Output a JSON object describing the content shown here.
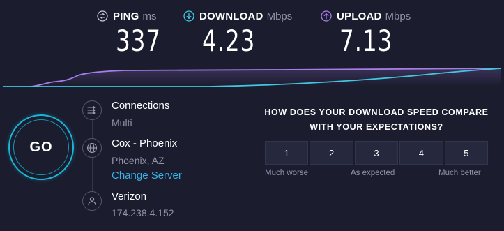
{
  "metrics": {
    "ping": {
      "label": "PING",
      "unit": "ms",
      "value": "337",
      "icon": "ping-icon",
      "color": "#ffffff"
    },
    "download": {
      "label": "DOWNLOAD",
      "unit": "Mbps",
      "value": "4.23",
      "icon": "download-arrow-icon",
      "color": "#41c8e0"
    },
    "upload": {
      "label": "UPLOAD",
      "unit": "Mbps",
      "value": "7.13",
      "icon": "upload-arrow-icon",
      "color": "#a77de8"
    }
  },
  "go_button": {
    "label": "GO"
  },
  "connections": {
    "title": "Connections",
    "mode": "Multi",
    "icon": "connections-icon"
  },
  "server": {
    "name": "Cox - Phoenix",
    "location": "Phoenix, AZ",
    "change_label": "Change Server",
    "icon": "globe-icon"
  },
  "provider": {
    "name": "Verizon",
    "ip": "174.238.4.152",
    "icon": "user-icon"
  },
  "survey": {
    "question_line1": "HOW DOES YOUR DOWNLOAD SPEED COMPARE",
    "question_line2": "WITH YOUR EXPECTATIONS?",
    "options": [
      "1",
      "2",
      "3",
      "4",
      "5"
    ],
    "caption_left": "Much worse",
    "caption_mid": "As expected",
    "caption_right": "Much better"
  },
  "colors": {
    "background": "#1b1c2e",
    "download_line": "#41c8e0",
    "upload_line": "#a77de8",
    "go_ring": "#1bb6d6",
    "link": "#38b2e8"
  }
}
